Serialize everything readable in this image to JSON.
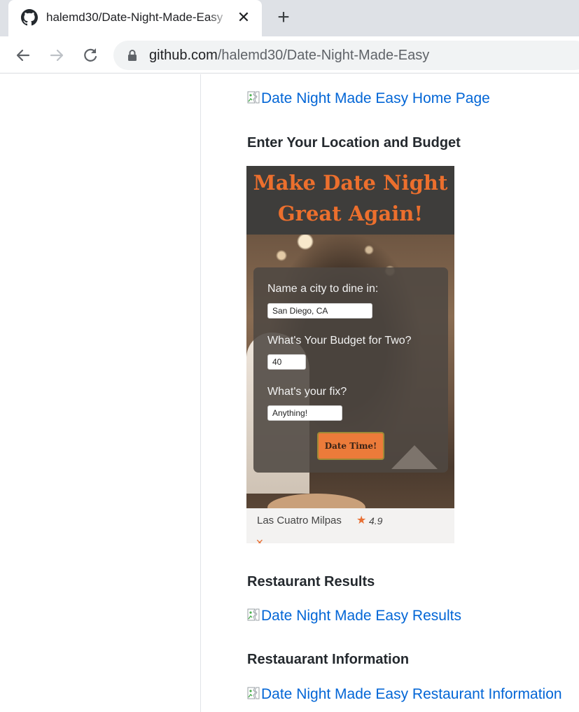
{
  "browser": {
    "tab_title": "halemd30/Date-Night-Made-Easy",
    "close_glyph": "✕",
    "new_tab_glyph": "+",
    "url_host": "github.com",
    "url_path": "/halemd30/Date-Night-Made-Easy"
  },
  "readme": {
    "home_image_alt": "Date Night Made Easy Home Page",
    "heading_location": "Enter Your Location and Budget",
    "heading_results": "Restaurant Results",
    "results_image_alt": "Date Night Made Easy Results",
    "heading_information": "Restauarant Information",
    "information_image_alt": "Date Night Made Easy Restaurant Information"
  },
  "app_preview": {
    "title_line1": "Make Date Night",
    "title_line2": "Great Again!",
    "city_label": "Name a city to dine in:",
    "city_value": "San Diego, CA",
    "budget_label": "What's Your Budget for Two?",
    "budget_value": "40",
    "fix_label": "What's your fix?",
    "fix_value": "Anything!",
    "submit_label": "Date Time!",
    "result_name": "Las Cuatro Milpas",
    "result_star": "★",
    "result_rating": "4.9",
    "accent_color": "#ec6f2d"
  },
  "icons": [
    "github-icon",
    "close-icon",
    "plus-icon",
    "back-arrow-icon",
    "forward-arrow-icon",
    "reload-icon",
    "lock-icon",
    "broken-image-icon",
    "star-icon"
  ]
}
